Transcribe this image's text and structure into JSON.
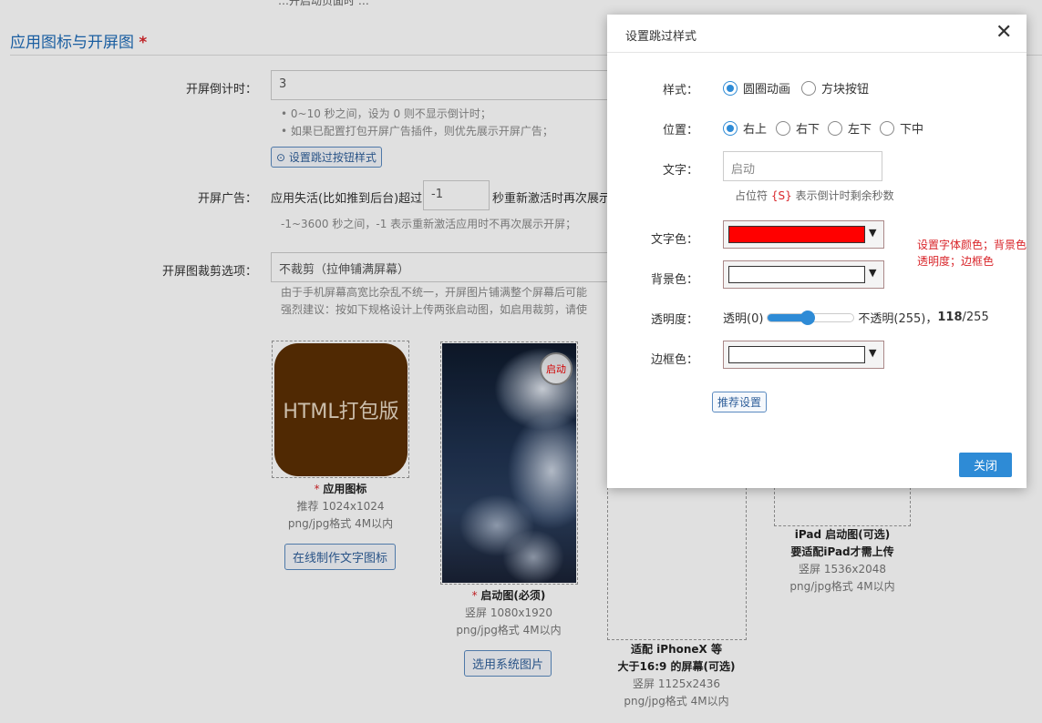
{
  "page": {
    "clipped_top_text": "…开启动页面时 …",
    "section_title": "应用图标与开屏图",
    "required_mark": "*",
    "countdown": {
      "label": "开屏倒计时：",
      "value": "3",
      "hints": [
        "• 0~10 秒之间，设为 0 则不显示倒计时；",
        "• 如果已配置打包开屏广告插件，则优先展示开屏广告；"
      ],
      "skip_style_button": "⊙ 设置跳过按钮样式"
    },
    "ad": {
      "label": "开屏广告：",
      "prefix": "应用失活(比如推到后台)超过",
      "value": "-1",
      "suffix": "秒重新激活时再次展示",
      "hint": "-1~3600 秒之间，-1 表示重新激活应用时不再次展示开屏；"
    },
    "crop": {
      "label": "开屏图裁剪选项：",
      "value": "不裁剪（拉伸铺满屏幕）",
      "hints": [
        "由于手机屏幕高宽比杂乱不统一，开屏图片铺满整个屏幕后可能",
        "强烈建议：按如下规格设计上传两张启动图，如启用裁剪，请使"
      ]
    },
    "cards": {
      "app_icon": {
        "tile_text": "HTML打包版",
        "title": "应用图标",
        "size": "推荐 1024x1024",
        "format": "png/jpg格式 4M以内",
        "button": "在线制作文字图标"
      },
      "splash": {
        "badge": "启动",
        "title": "启动图(必须)",
        "size": "竖屏 1080x1920",
        "format": "png/jpg格式 4M以内",
        "button": "选用系统图片"
      },
      "iphonex": {
        "title_line1": "适配 iPhoneX 等",
        "title_line2": "大于16:9 的屏幕(可选)",
        "size": "竖屏 1125x2436",
        "format": "png/jpg格式 4M以内"
      },
      "ipad": {
        "title_line1": "iPad 启动图(可选)",
        "title_line2": "要适配iPad才需上传",
        "size": "竖屏 1536x2048",
        "format": "png/jpg格式 4M以内"
      }
    }
  },
  "modal": {
    "title": "设置跳过样式",
    "close_glyph": "✕",
    "style": {
      "label": "样式：",
      "options": [
        {
          "label": "圆圈动画",
          "selected": true
        },
        {
          "label": "方块按钮",
          "selected": false
        }
      ]
    },
    "position": {
      "label": "位置：",
      "options": [
        {
          "label": "右上",
          "selected": true
        },
        {
          "label": "右下",
          "selected": false
        },
        {
          "label": "左下",
          "selected": false
        },
        {
          "label": "下中",
          "selected": false
        }
      ]
    },
    "text": {
      "label": "文字：",
      "value": "启动",
      "note_prefix": "占位符",
      "note_token": "{S}",
      "note_suffix": "表示倒计时剩余秒数"
    },
    "text_color": {
      "label": "文字色：",
      "color": "#ff0000"
    },
    "bg_color": {
      "label": "背景色：",
      "color": "#ffffff"
    },
    "opacity": {
      "label": "透明度：",
      "min_label": "透明(0)",
      "max_label": "不透明(255)，",
      "value": "118",
      "max": "/255",
      "fraction": 0.4627
    },
    "border_color": {
      "label": "边框色：",
      "color": "#ffffff"
    },
    "side_note_line1": "设置字体颜色；背景色",
    "side_note_line2": "透明度；边框色",
    "recommend_button": "推荐设置",
    "close_button": "关闭"
  },
  "colors": {
    "accent": "#2e8bd6",
    "link_blue": "#1e6bb8",
    "required_red": "#d9262b",
    "icon_brown": "#5c2f04"
  },
  "icons": {
    "close": "close-icon",
    "radio": "radio-icon",
    "dropdown": "dropdown-arrow-icon",
    "clock": "clock-icon"
  }
}
